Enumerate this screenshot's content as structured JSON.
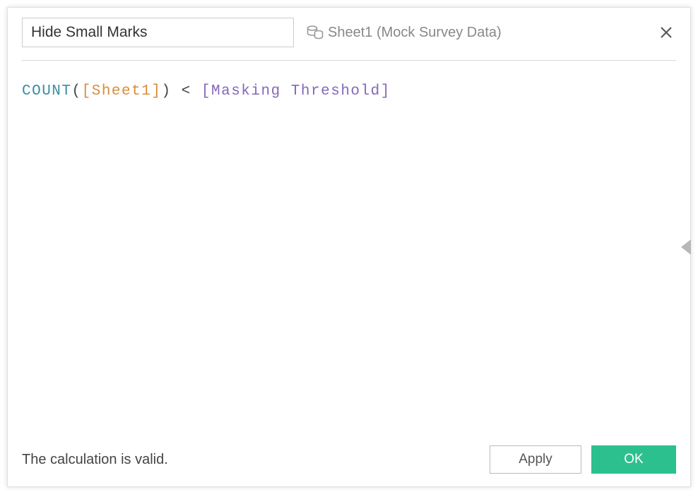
{
  "header": {
    "calc_name": "Hide Small Marks",
    "datasource_label": "Sheet1 (Mock Survey Data)"
  },
  "formula": {
    "func": "COUNT",
    "paren_open": "(",
    "field": "[Sheet1]",
    "paren_close": ")",
    "operator": "<",
    "param": "[Masking Threshold]"
  },
  "footer": {
    "status": "The calculation is valid.",
    "apply_label": "Apply",
    "ok_label": "OK"
  }
}
